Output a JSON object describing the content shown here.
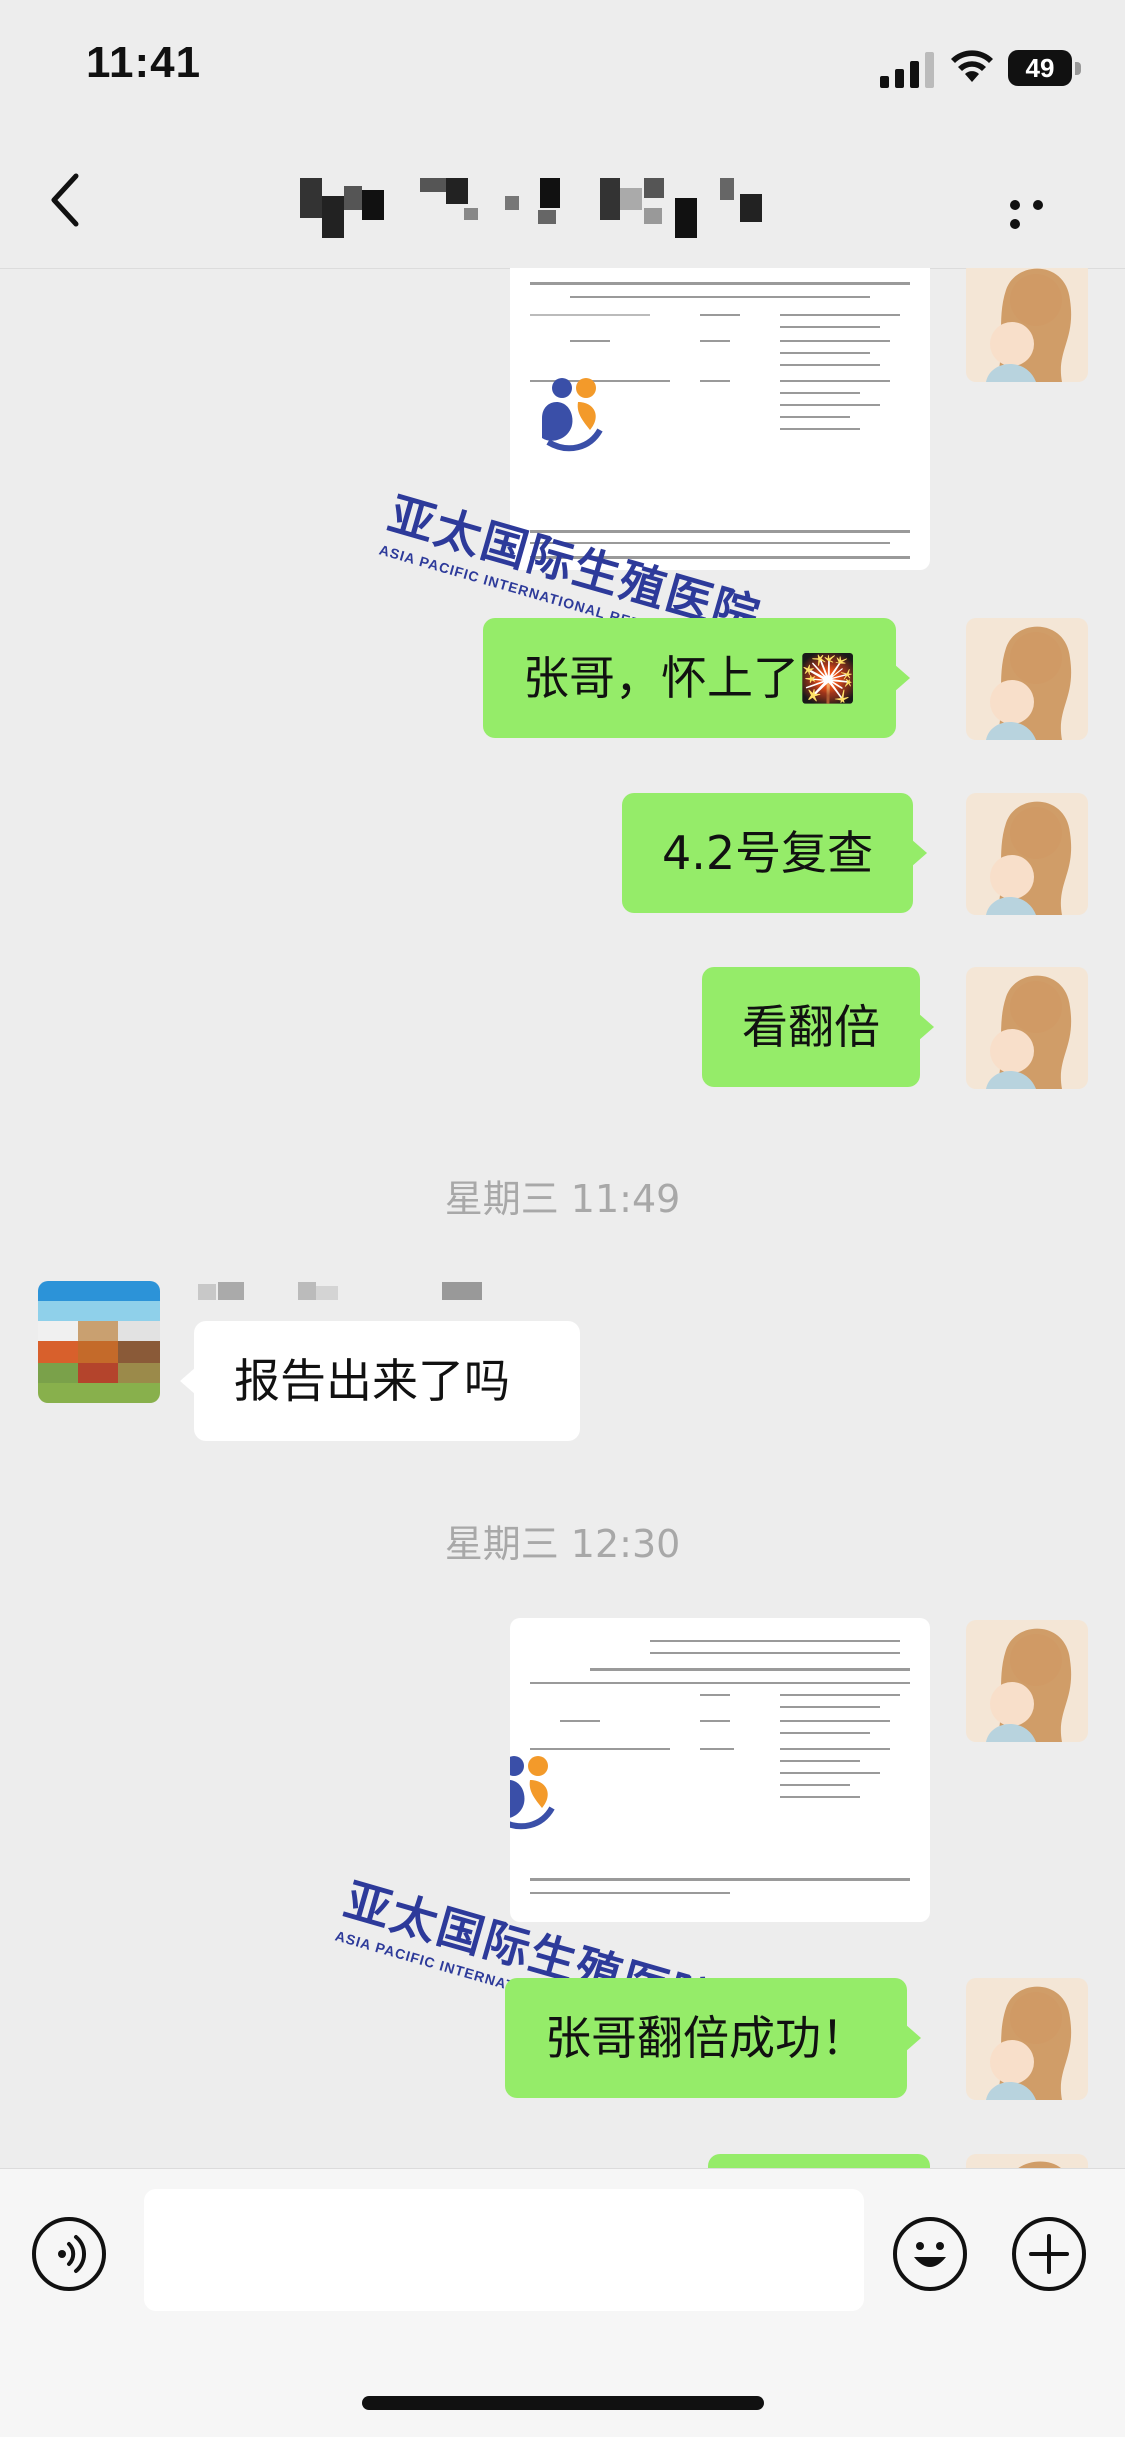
{
  "status_bar": {
    "time": "11:41",
    "battery": "49"
  },
  "nav": {
    "title": "",
    "back_icon": "chevron-left-icon",
    "more_icon": "ellipsis-icon"
  },
  "messages": {
    "m1": "张哥，怀上了🎇",
    "m2": "4.2号复查",
    "m3": "看翻倍",
    "ts1": "星期三 11:49",
    "m4": "报告出来了吗",
    "ts2": "星期三 12:30",
    "m5": "张哥翻倍成功！"
  },
  "watermark": {
    "cn": "亚太国际生殖医院",
    "en": "ASIA PACIFIC INTERNATIONAL REPRODUCTIVE HOSPITAL"
  },
  "input_bar": {
    "voice_icon": "voice-icon",
    "emoji_icon": "emoji-icon",
    "plus_icon": "plus-icon"
  },
  "colors": {
    "bubble_out": "#95ec69",
    "bubble_in": "#ffffff",
    "background": "#ededed"
  }
}
